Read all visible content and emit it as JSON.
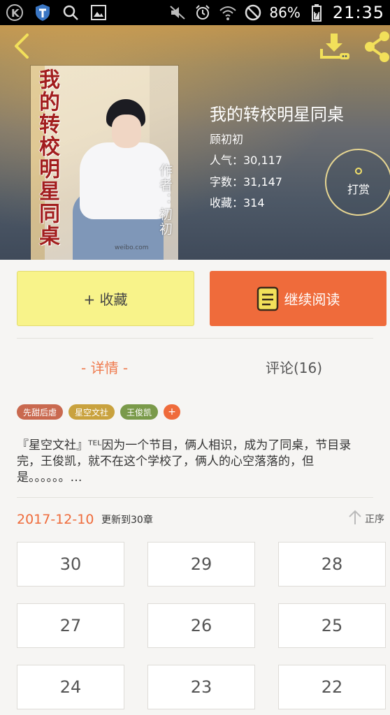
{
  "status_bar": {
    "battery": "86%",
    "time": "21:35",
    "icons": [
      "k-app-icon",
      "shield-icon",
      "search-icon",
      "image-icon",
      "mute-icon",
      "alarm-icon",
      "wifi-icon",
      "block-icon",
      "battery-charging-icon"
    ]
  },
  "book": {
    "title": "我的转校明星同桌",
    "author": "顾初初",
    "popularity": "人气：30,117",
    "word_count": "字数：31,147",
    "favorites": "收藏：314",
    "cover_title": "我的转校明星同桌",
    "cover_author": "作者：初初",
    "cover_watermark": "weibo.com"
  },
  "actions": {
    "tip_label": "打赏",
    "favorite_label": "+ 收藏",
    "read_label": "继续阅读"
  },
  "tabs": {
    "detail": "- 详情 -",
    "comments": "评论(16)"
  },
  "tags": [
    {
      "label": "先甜后虐",
      "color": "#c9694f"
    },
    {
      "label": "星空文社",
      "color": "#c9a23e"
    },
    {
      "label": "王俊凯",
      "color": "#7a9a4a"
    }
  ],
  "tag_add": "+",
  "summary": "『星空文社』ᵀᴱᴸ因为一个节目，俩人相识，成为了同桌，节目录完，王俊凯，就不在这个学校了，俩人的心空落落的，但是。。。。。。…",
  "update": {
    "date": "2017-12-10",
    "text": "更新到30章",
    "sort_label": "正序"
  },
  "chapters": [
    "30",
    "29",
    "28",
    "27",
    "26",
    "25",
    "24",
    "23",
    "22"
  ],
  "colors": {
    "accent": "#ef6b3b",
    "favorite_button": "#f8f38a",
    "tip_ring": "#e7d692"
  }
}
